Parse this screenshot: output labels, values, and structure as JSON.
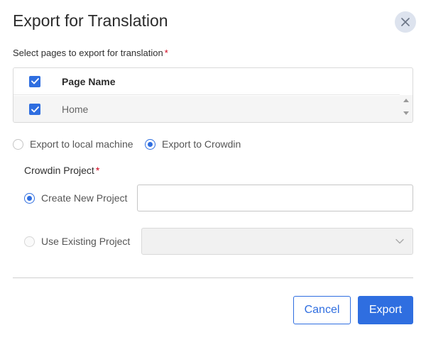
{
  "dialog": {
    "title": "Export for Translation",
    "close_icon": "close-icon"
  },
  "pages_section": {
    "label": "Select pages to export for translation",
    "required_mark": "*",
    "header": {
      "column": "Page Name",
      "checked": true
    },
    "rows": [
      {
        "name": "Home",
        "checked": true
      }
    ]
  },
  "export_target": {
    "options": [
      {
        "label": "Export to local machine",
        "selected": false
      },
      {
        "label": "Export to Crowdin",
        "selected": true
      }
    ]
  },
  "crowdin_project": {
    "label": "Crowdin Project",
    "required_mark": "*",
    "create_new": {
      "label": "Create New Project",
      "selected": true,
      "value": ""
    },
    "use_existing": {
      "label": "Use Existing Project",
      "selected": false,
      "disabled": true,
      "selected_value": ""
    }
  },
  "footer": {
    "cancel_label": "Cancel",
    "export_label": "Export"
  },
  "colors": {
    "accent": "#2f6ee0",
    "required": "#d0021b",
    "close_bg": "#dde3ee"
  }
}
